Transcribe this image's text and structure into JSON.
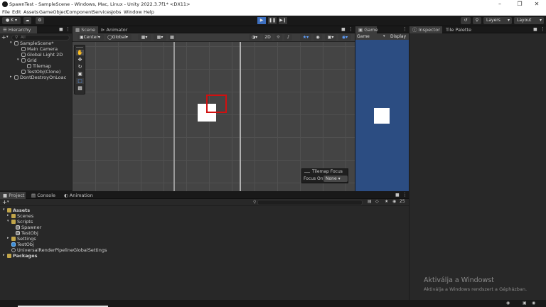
{
  "window": {
    "title": "SpawnTest - SampleScene - Windows, Mac, Linux - Unity 2022.3.7f1* <DX11>",
    "controls": [
      "–",
      "❐",
      "✕"
    ]
  },
  "menu": [
    "File",
    "Edit",
    "Assets",
    "GameObject",
    "Component",
    "Services",
    "Jobs",
    "Window",
    "Help"
  ],
  "toolbar": {
    "account_initial": "K",
    "layers": "Layers",
    "layout": "Layout"
  },
  "hierarchy": {
    "tab": "Hierarchy",
    "search_placeholder": "All",
    "items": [
      {
        "label": "SampleScene*",
        "depth": 0
      },
      {
        "label": "Main Camera",
        "depth": 1
      },
      {
        "label": "Global Light 2D",
        "depth": 1
      },
      {
        "label": "Grid",
        "depth": 1
      },
      {
        "label": "Tilemap",
        "depth": 2
      },
      {
        "label": "TestObj(Clone)",
        "depth": 1
      },
      {
        "label": "DontDestroyOnLoac",
        "depth": 0
      }
    ]
  },
  "scene": {
    "tabs": [
      "Scene",
      "Animator"
    ],
    "pivot": "Center",
    "space": "Global",
    "mode_2d": "2D",
    "tilemap_focus": {
      "title": "Tilemap Focus",
      "label": "Focus On",
      "value": "None"
    }
  },
  "game": {
    "tab": "Game",
    "mode": "Game",
    "display": "Display"
  },
  "inspector": {
    "tabs": [
      "Inspector",
      "Tile Palette"
    ]
  },
  "project": {
    "tabs": [
      "Project",
      "Console",
      "Animation"
    ],
    "count": "25",
    "tree": [
      {
        "label": "Assets",
        "depth": 0,
        "type": "folder"
      },
      {
        "label": "Scenes",
        "depth": 1,
        "type": "folder"
      },
      {
        "label": "Scripts",
        "depth": 1,
        "type": "folder"
      },
      {
        "label": "Spawner",
        "depth": 2,
        "type": "script"
      },
      {
        "label": "TestObj",
        "depth": 2,
        "type": "script"
      },
      {
        "label": "Settings",
        "depth": 1,
        "type": "folder"
      },
      {
        "label": "TestObj",
        "depth": 1,
        "type": "prefab"
      },
      {
        "label": "UniversalRenderPipelineGlobalSettings",
        "depth": 1,
        "type": "asset"
      },
      {
        "label": "Packages",
        "depth": 0,
        "type": "folder"
      }
    ]
  },
  "watermark": {
    "line1": "Aktiválja a Windowst",
    "line2": "Aktiválja a Windows rendszert a Gépházban."
  },
  "colors": {
    "game_bg": "#2c4d82",
    "selection": "#d01010",
    "accent": "#3d6fbf"
  }
}
